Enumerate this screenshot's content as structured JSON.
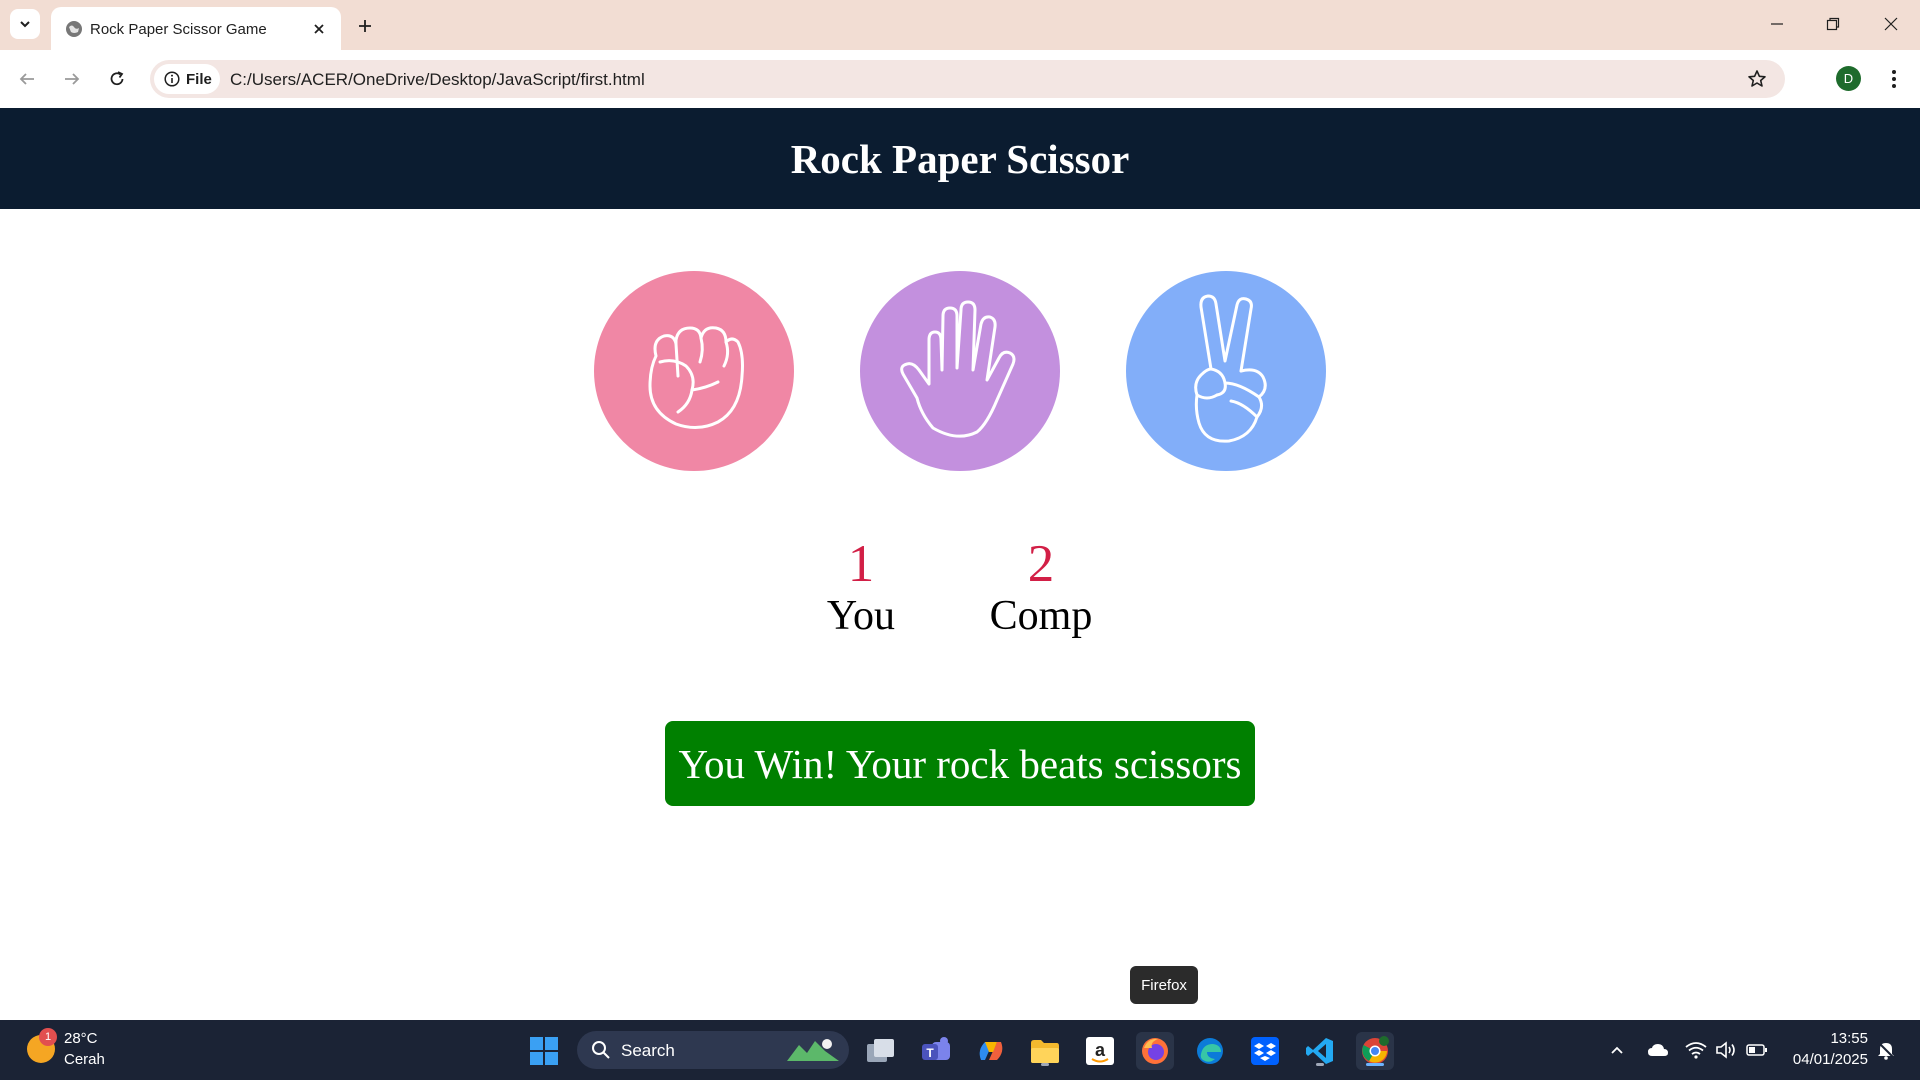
{
  "browser": {
    "tab_title": "Rock Paper Scissor Game",
    "site_chip_label": "File",
    "url": "C:/Users/ACER/OneDrive/Desktop/JavaScript/first.html",
    "profile_initial": "D"
  },
  "page": {
    "title": "Rock Paper Scissor",
    "choices": [
      {
        "name": "rock",
        "color": "#f087a5",
        "icon": "fist-icon"
      },
      {
        "name": "paper",
        "color": "#c390de",
        "icon": "open-hand-icon"
      },
      {
        "name": "scissors",
        "color": "#82aef9",
        "icon": "peace-hand-icon"
      }
    ],
    "scores": {
      "user_score": "1",
      "user_label": "You",
      "comp_score": "2",
      "comp_label": "Comp"
    },
    "message": "You Win! Your rock beats scissors",
    "message_color": "#008000",
    "header_color": "#0b1c30",
    "score_color": "#d21f46"
  },
  "tooltip": "Firefox",
  "taskbar": {
    "weather_temp": "28°C",
    "weather_condition": "Cerah",
    "weather_badge": "1",
    "search_label": "Search",
    "apps": [
      "start-icon",
      "search-icon",
      "task-view-icon",
      "teams-icon",
      "copilot-icon",
      "file-explorer-icon",
      "amazon-icon",
      "firefox-icon",
      "edge-icon",
      "dropbox-icon",
      "vscode-icon",
      "chrome-icon"
    ],
    "time": "13:55",
    "date": "04/01/2025"
  }
}
